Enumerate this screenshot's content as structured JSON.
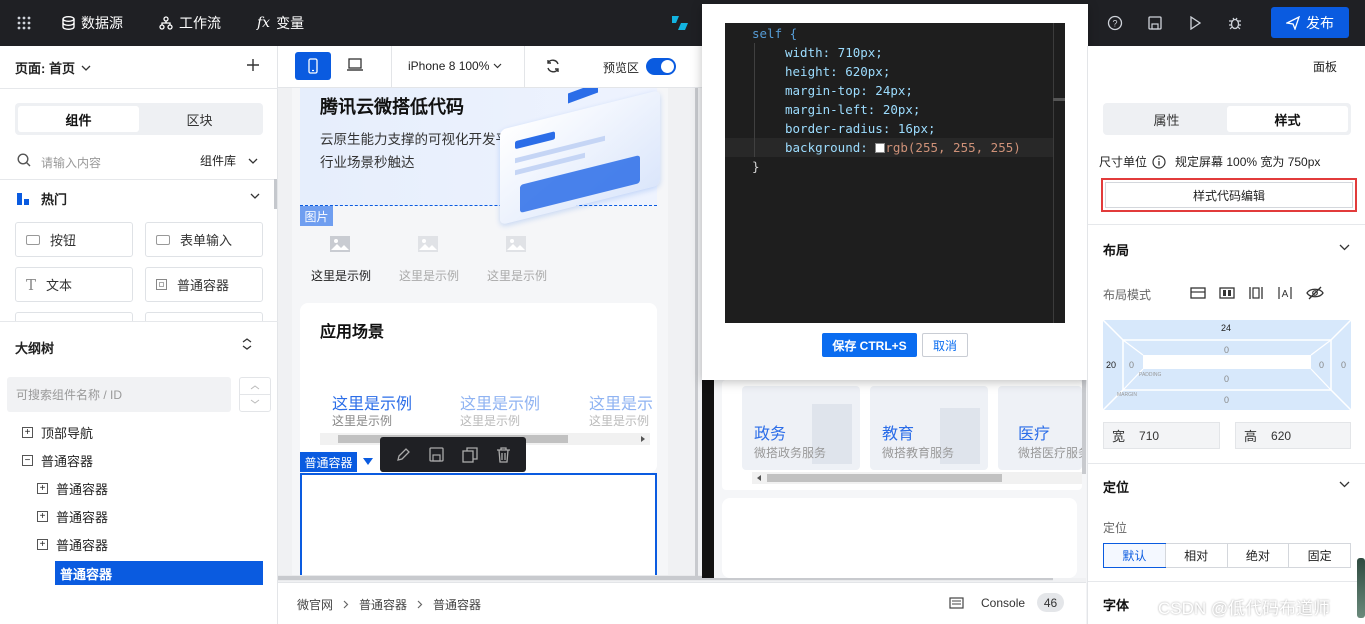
{
  "topbar": {
    "datasource": "数据源",
    "workflow": "工作流",
    "variables": "变量",
    "publish": "发布"
  },
  "left": {
    "page_selector": "页面: 首页",
    "tabs": [
      "组件",
      "区块"
    ],
    "search_placeholder": "请输入内容",
    "library": "组件库",
    "hot": "热门",
    "components": [
      "按钮",
      "表单输入",
      "文本",
      "普通容器"
    ],
    "outline_title": "大纲树",
    "outline_search_placeholder": "可搜索组件名称 / ID",
    "tree": [
      "顶部导航",
      "普通容器",
      "普通容器",
      "普通容器",
      "普通容器",
      "普通容器"
    ]
  },
  "canvas": {
    "device": "iPhone 8 100%",
    "preview": "预览区",
    "banner_title": "腾讯云微搭低代码",
    "banner_desc1": "云原生能力支撑的可视化开发平台,",
    "banner_desc2": "行业场景秒触达",
    "image_tag": "图片",
    "grid_items": [
      "这里是示例",
      "这里是示例",
      "这里是示例"
    ],
    "scene_title": "应用场景",
    "scene_items": [
      {
        "title": "这里是示例",
        "sub": "这里是示例"
      },
      {
        "title": "这里是示例",
        "sub": "这里是示例"
      },
      {
        "title": "这里是示",
        "sub": "这里是示例"
      }
    ],
    "selected_tag": "普通容器",
    "right_cards": [
      {
        "title": "政务",
        "sub": "微搭政务服务"
      },
      {
        "title": "教育",
        "sub": "微搭教育服务"
      },
      {
        "title": "医疗",
        "sub": "微搭医疗服务"
      }
    ]
  },
  "modal": {
    "code_lines": [
      "self {",
      "width: 710px;",
      "height: 620px;",
      "margin-top: 24px;",
      "margin-left: 20px;",
      "border-radius: 16px;",
      "background:",
      "rgb(255, 255, 255)",
      "}"
    ],
    "save": "保存 CTRL+S",
    "cancel": "取消"
  },
  "right": {
    "panel": "面板",
    "tabs": [
      "属性",
      "样式"
    ],
    "unit_label": "尺寸单位",
    "unit_value": "规定屏幕 100% 宽为 750px",
    "style_code_btn": "样式代码编辑",
    "layout": "布局",
    "layout_mode": "布局模式",
    "box": {
      "margin_top": "24",
      "margin_left": "20",
      "padding": "0",
      "small1": "PADDING",
      "small2": "MARGIN"
    },
    "width_label": "宽",
    "width": "710",
    "height_label": "高",
    "height": "620",
    "position": "定位",
    "position_label": "定位",
    "position_opts": [
      "默认",
      "相对",
      "绝对",
      "固定"
    ],
    "font": "字体"
  },
  "bottom": {
    "breadcrumb": [
      "微官网",
      "普通容器",
      "普通容器"
    ],
    "console": "Console",
    "count": "46",
    "watermark": "CSDN @低代码布道师"
  }
}
